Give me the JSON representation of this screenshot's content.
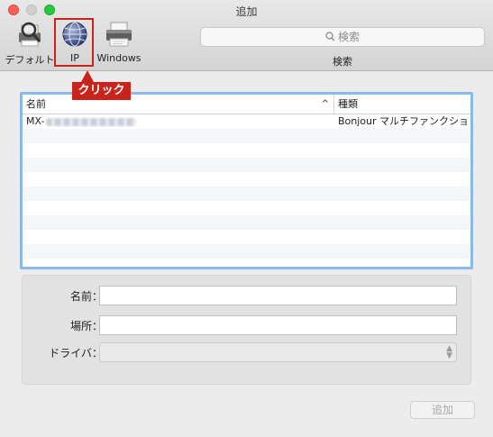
{
  "window": {
    "title": "追加"
  },
  "toolbar": {
    "tools": [
      {
        "label": "デフォルト",
        "icon": "default-printers-icon"
      },
      {
        "label": "IP",
        "icon": "ip-globe-icon"
      },
      {
        "label": "Windows",
        "icon": "windows-printer-icon"
      }
    ],
    "search": {
      "placeholder": "検索",
      "label": "検索"
    }
  },
  "annotation": {
    "callout_text": "クリック",
    "color": "#c9241c"
  },
  "printer_list": {
    "columns": {
      "name": "名前",
      "kind": "種類"
    },
    "rows": [
      {
        "name": "MX-",
        "kind": "Bonjour マルチファンクション"
      }
    ],
    "empty_rows": 10
  },
  "form": {
    "name_label": "名前：",
    "location_label": "場所：",
    "driver_label": "ドライバ：",
    "name_value": "",
    "location_value": "",
    "driver_value": ""
  },
  "footer": {
    "add_button": "追加"
  },
  "colors": {
    "selection_border": "#8cb9ec",
    "close": "#ff5f57",
    "zoom": "#28c940"
  }
}
